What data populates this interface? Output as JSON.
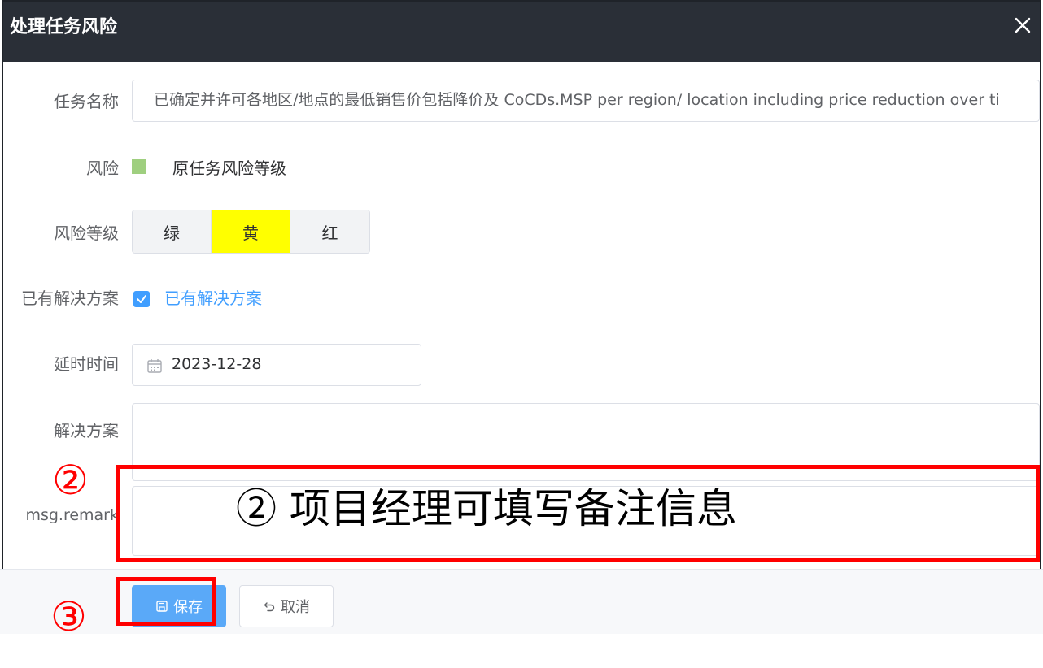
{
  "dialog": {
    "title": "处理任务风险",
    "close_icon": "close-icon"
  },
  "form": {
    "task_name_label": "任务名称",
    "task_name_value": "已确定并许可各地区/地点的最低销售价包括降价及 CoCDs.MSP per region/ location  including price reduction over ti",
    "risk_label": "风险",
    "risk_color": "#9fcf7f",
    "risk_original_text": "原任务风险等级",
    "risk_level_label": "风险等级",
    "risk_levels": [
      {
        "label": "绿",
        "selected": false
      },
      {
        "label": "黄",
        "selected": true
      },
      {
        "label": "红",
        "selected": false
      }
    ],
    "has_solution_label": "已有解决方案",
    "has_solution_checkbox_label": "已有解决方案",
    "has_solution_checked": true,
    "delay_label": "延时时间",
    "delay_value": "2023-12-28",
    "solution_label": "解决方案",
    "remark_label": "msg.remark"
  },
  "footer": {
    "save_label": "保存",
    "cancel_label": "取消"
  },
  "annotations": {
    "marker_2": "②",
    "marker_3": "③",
    "note_text": "② 项目经理可填写备注信息"
  },
  "colors": {
    "titlebar": "#2a2f37",
    "accent": "#409eff",
    "selected_level": "#ffff00",
    "annotation": "#ff0000"
  }
}
